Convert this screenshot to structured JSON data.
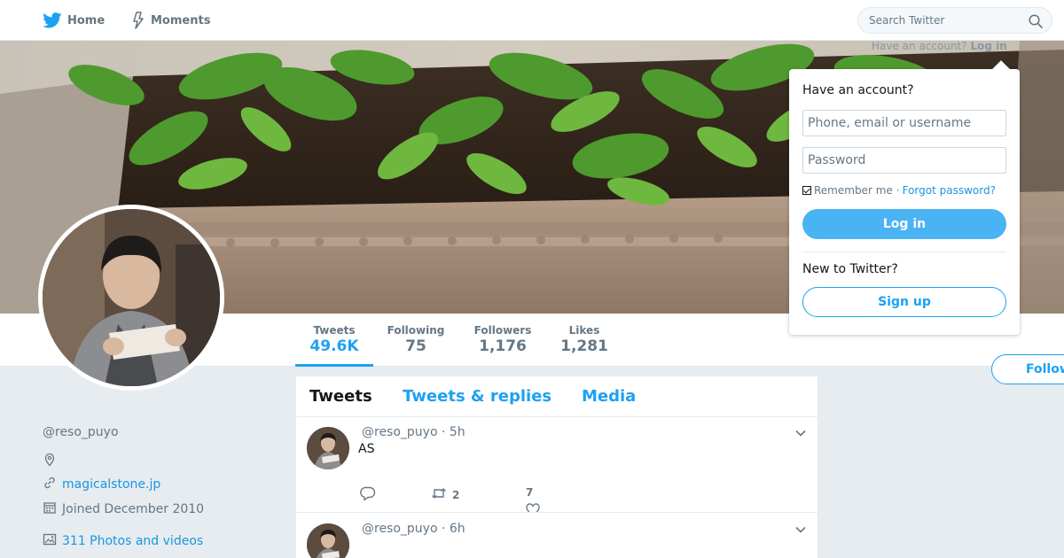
{
  "nav": {
    "home_label": "Home",
    "moments_label": "Moments",
    "search_placeholder": "Search Twitter"
  },
  "login_hint": {
    "prefix": "Have an account?",
    "link": "Log in"
  },
  "login_panel": {
    "title": "Have an account?",
    "username_placeholder": "Phone, email or username",
    "password_placeholder": "Password",
    "remember_label": "Remember me",
    "separator": "·",
    "forgot_label": "Forgot password?",
    "login_button": "Log in",
    "new_label": "New to Twitter?",
    "signup_button": "Sign up"
  },
  "profile_nav": {
    "stats": [
      {
        "label": "Tweets",
        "value": "49.6K",
        "active": true
      },
      {
        "label": "Following",
        "value": "75",
        "active": false
      },
      {
        "label": "Followers",
        "value": "1,176",
        "active": false
      },
      {
        "label": "Likes",
        "value": "1,281",
        "active": false
      }
    ],
    "follow_button": "Follow"
  },
  "profile": {
    "name": "",
    "handle": "@reso_puyo",
    "website": "magicalstone.jp",
    "joined": "Joined December 2010",
    "photos": "311 Photos and videos"
  },
  "timeline": {
    "tabs": [
      "Tweets",
      "Tweets & replies",
      "Media"
    ],
    "tweets": [
      {
        "handle": "@reso_puyo",
        "time": "· 5h",
        "text": "AS",
        "retweets": "2",
        "likes": "7"
      },
      {
        "handle": "@reso_puyo",
        "time": "· 6h",
        "text": "",
        "retweets": "",
        "likes": ""
      }
    ]
  },
  "colors": {
    "accent": "#1da1f2",
    "link": "#1b95e0",
    "login_button": "#4ab3f4",
    "background": "#e6ecf0",
    "muted_text": "#657786"
  },
  "icons": [
    "twitter-bird-icon",
    "lightning-icon",
    "search-icon",
    "location-pin-icon",
    "link-icon",
    "calendar-icon",
    "photo-icon",
    "reply-icon",
    "retweet-icon",
    "heart-icon",
    "chevron-down-icon"
  ]
}
